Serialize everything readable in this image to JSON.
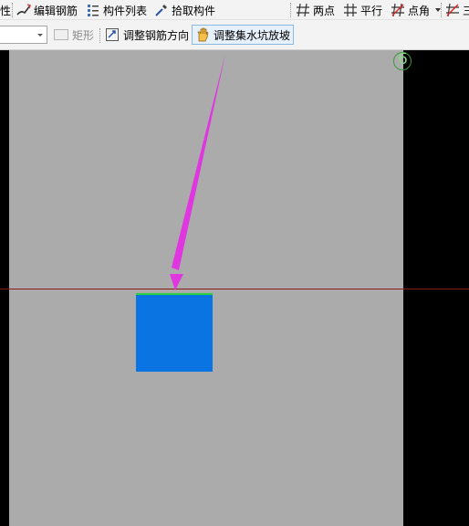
{
  "toolbar_top": {
    "items": [
      {
        "label": "性",
        "icon": "property-icon"
      },
      {
        "label": "编辑钢筋",
        "icon": "edit-rebar-icon"
      },
      {
        "label": "构件列表",
        "icon": "component-list-icon"
      },
      {
        "label": "拾取构件",
        "icon": "eyedropper-icon"
      },
      {
        "label": "两点",
        "icon": "two-point-axis-icon"
      },
      {
        "label": "平行",
        "icon": "parallel-axis-icon"
      },
      {
        "label": "点角",
        "icon": "point-angle-axis-icon"
      },
      {
        "label": "三",
        "icon": "three-point-axis-icon"
      }
    ]
  },
  "toolbar_second": {
    "combo_value": "",
    "rect_label": "矩形",
    "adjust_rebar_direction": "调整钢筋方向",
    "adjust_pit_slope": "调整集水坑放坡"
  },
  "canvas": {
    "coord_label": "6",
    "colors": {
      "drawing_area": "#ababab",
      "pit_fill": "#0a74e3",
      "pit_edge": "#29d140",
      "arrow": "#e036e0",
      "axis_line": "#8a1a1a"
    }
  }
}
